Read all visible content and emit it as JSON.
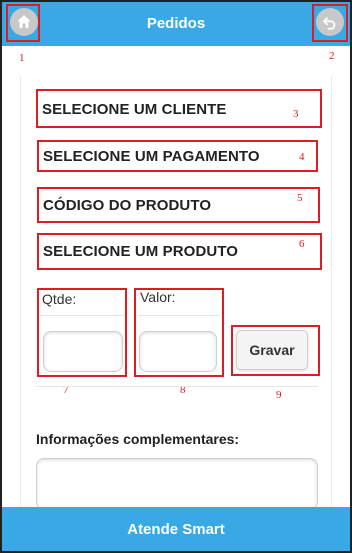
{
  "header": {
    "title": "Pedidos",
    "home_icon": "home-icon",
    "back_icon": "undo-icon"
  },
  "annotations": [
    "1",
    "2",
    "3",
    "4",
    "5",
    "6",
    "7",
    "8",
    "9"
  ],
  "form": {
    "cliente_select": "SELECIONE UM CLIENTE",
    "pagamento_select": "SELECIONE UM PAGAMENTO",
    "codigo_field": "CÓDIGO DO PRODUTO",
    "produto_select": "SELECIONE UM PRODUTO",
    "qtde_label": "Qtde:",
    "qtde_value": "",
    "valor_label": "Valor:",
    "valor_value": "",
    "gravar_label": "Gravar",
    "info_label": "Informações complementares:",
    "info_value": ""
  },
  "footer": {
    "title": "Atende Smart"
  },
  "colors": {
    "header": "#38a9e5",
    "annotation": "#dd1c24"
  }
}
